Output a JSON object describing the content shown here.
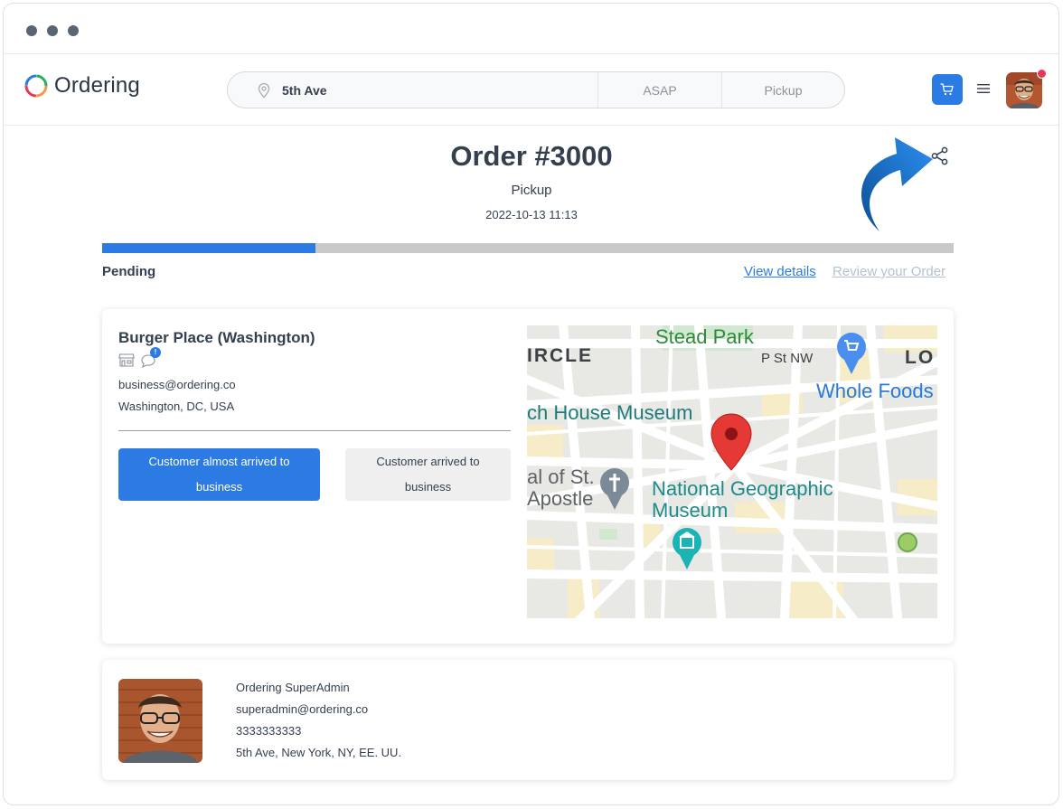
{
  "window": {
    "controls": [
      "dot",
      "dot",
      "dot"
    ]
  },
  "header": {
    "logo_text": "Ordering",
    "address": "5th Ave",
    "time": "ASAP",
    "order_type": "Pickup",
    "accent_color": "#2c7be5",
    "icons": [
      "location-pin-icon",
      "cart-icon",
      "hamburger-menu-icon"
    ]
  },
  "order": {
    "title": "Order #3000",
    "type": "Pickup",
    "date": "2022-10-13 11:13",
    "status": "Pending",
    "progress_percent": 25,
    "view_details": "View details",
    "review": "Review your Order"
  },
  "business": {
    "name": "Burger Place (Washington)",
    "email": "business@ordering.co",
    "address": "Washington, DC, USA",
    "chat_badge": "!",
    "btn_almost": "Customer almost arrived to business",
    "btn_arrived": "Customer arrived to business"
  },
  "map": {
    "labels": {
      "stead_park": "Stead Park",
      "circle": "IRCLE",
      "p_st": "P St NW",
      "lo": "LO",
      "whole_foods": "Whole Foods",
      "house_museum": "ch House Museum",
      "cathedral_1": "al of St.",
      "cathedral_2": "Apostle",
      "natgeo_1": "National Geographic",
      "natgeo_2": "Museum"
    }
  },
  "customer": {
    "name": "Ordering SuperAdmin",
    "email": "superadmin@ordering.co",
    "phone": "3333333333",
    "address": "5th Ave, New York, NY, EE. UU."
  }
}
